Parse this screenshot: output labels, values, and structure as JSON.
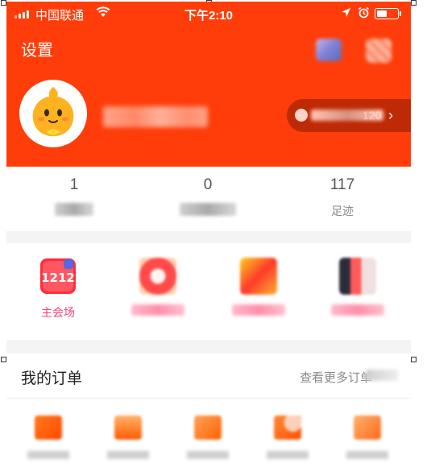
{
  "status_bar": {
    "carrier": "中国联通",
    "time": "下午2:10"
  },
  "header": {
    "settings_label": "设置",
    "member_number_fragment": "120"
  },
  "stats": [
    {
      "value": "1"
    },
    {
      "value": "0"
    },
    {
      "value": "117",
      "label": "足迹"
    }
  ],
  "promotions": [
    {
      "label": "主会场",
      "badge": "1212"
    },
    {
      "label": ""
    },
    {
      "label": ""
    },
    {
      "label": ""
    }
  ],
  "orders": {
    "title": "我的订单",
    "more_label": "查看更多订单"
  },
  "colors": {
    "brand_orange": "#ff3d0a",
    "promo_pink": "#ff3f74"
  },
  "icons": [
    "signal-icon",
    "wifi-icon",
    "location-icon",
    "alarm-icon",
    "battery-icon",
    "scan-icon",
    "message-icon",
    "chevron-right-icon"
  ]
}
